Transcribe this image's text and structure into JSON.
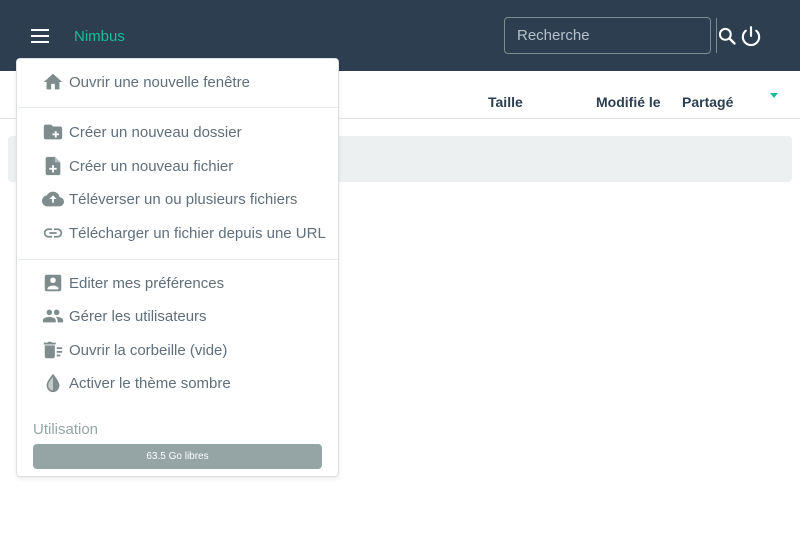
{
  "app": {
    "brand": "Nimbus"
  },
  "header": {
    "search_placeholder": "Recherche",
    "search_value": ""
  },
  "table": {
    "columns": [
      "Taille",
      "Modifié le",
      "Partagé"
    ]
  },
  "menu": {
    "items": [
      {
        "label": "Ouvrir une nouvelle fenêtre",
        "icon": "home-icon"
      },
      {
        "label": "Créer un nouveau dossier",
        "icon": "folder-plus-icon"
      },
      {
        "label": "Créer un nouveau fichier",
        "icon": "file-plus-icon"
      },
      {
        "label": "Téléverser un ou plusieurs fichiers",
        "icon": "cloud-upload-icon"
      },
      {
        "label": "Télécharger un fichier depuis une URL",
        "icon": "link-icon"
      },
      {
        "label": "Editer mes préférences",
        "icon": "account-box-icon"
      },
      {
        "label": "Gérer les utilisateurs",
        "icon": "users-icon"
      },
      {
        "label": "Ouvrir la corbeille (vide)",
        "icon": "trash-icon"
      },
      {
        "label": "Activer le thème sombre",
        "icon": "water-drop-icon"
      }
    ],
    "usage_label": "Utilisation",
    "usage_text": "63.5 Go libres",
    "usage_fraction": 1.0
  },
  "colors": {
    "header_bg": "#2c3e50",
    "accent": "#1abc9c",
    "icon_gray": "#7f8c8d",
    "usage_fill": "#95a5a6"
  }
}
